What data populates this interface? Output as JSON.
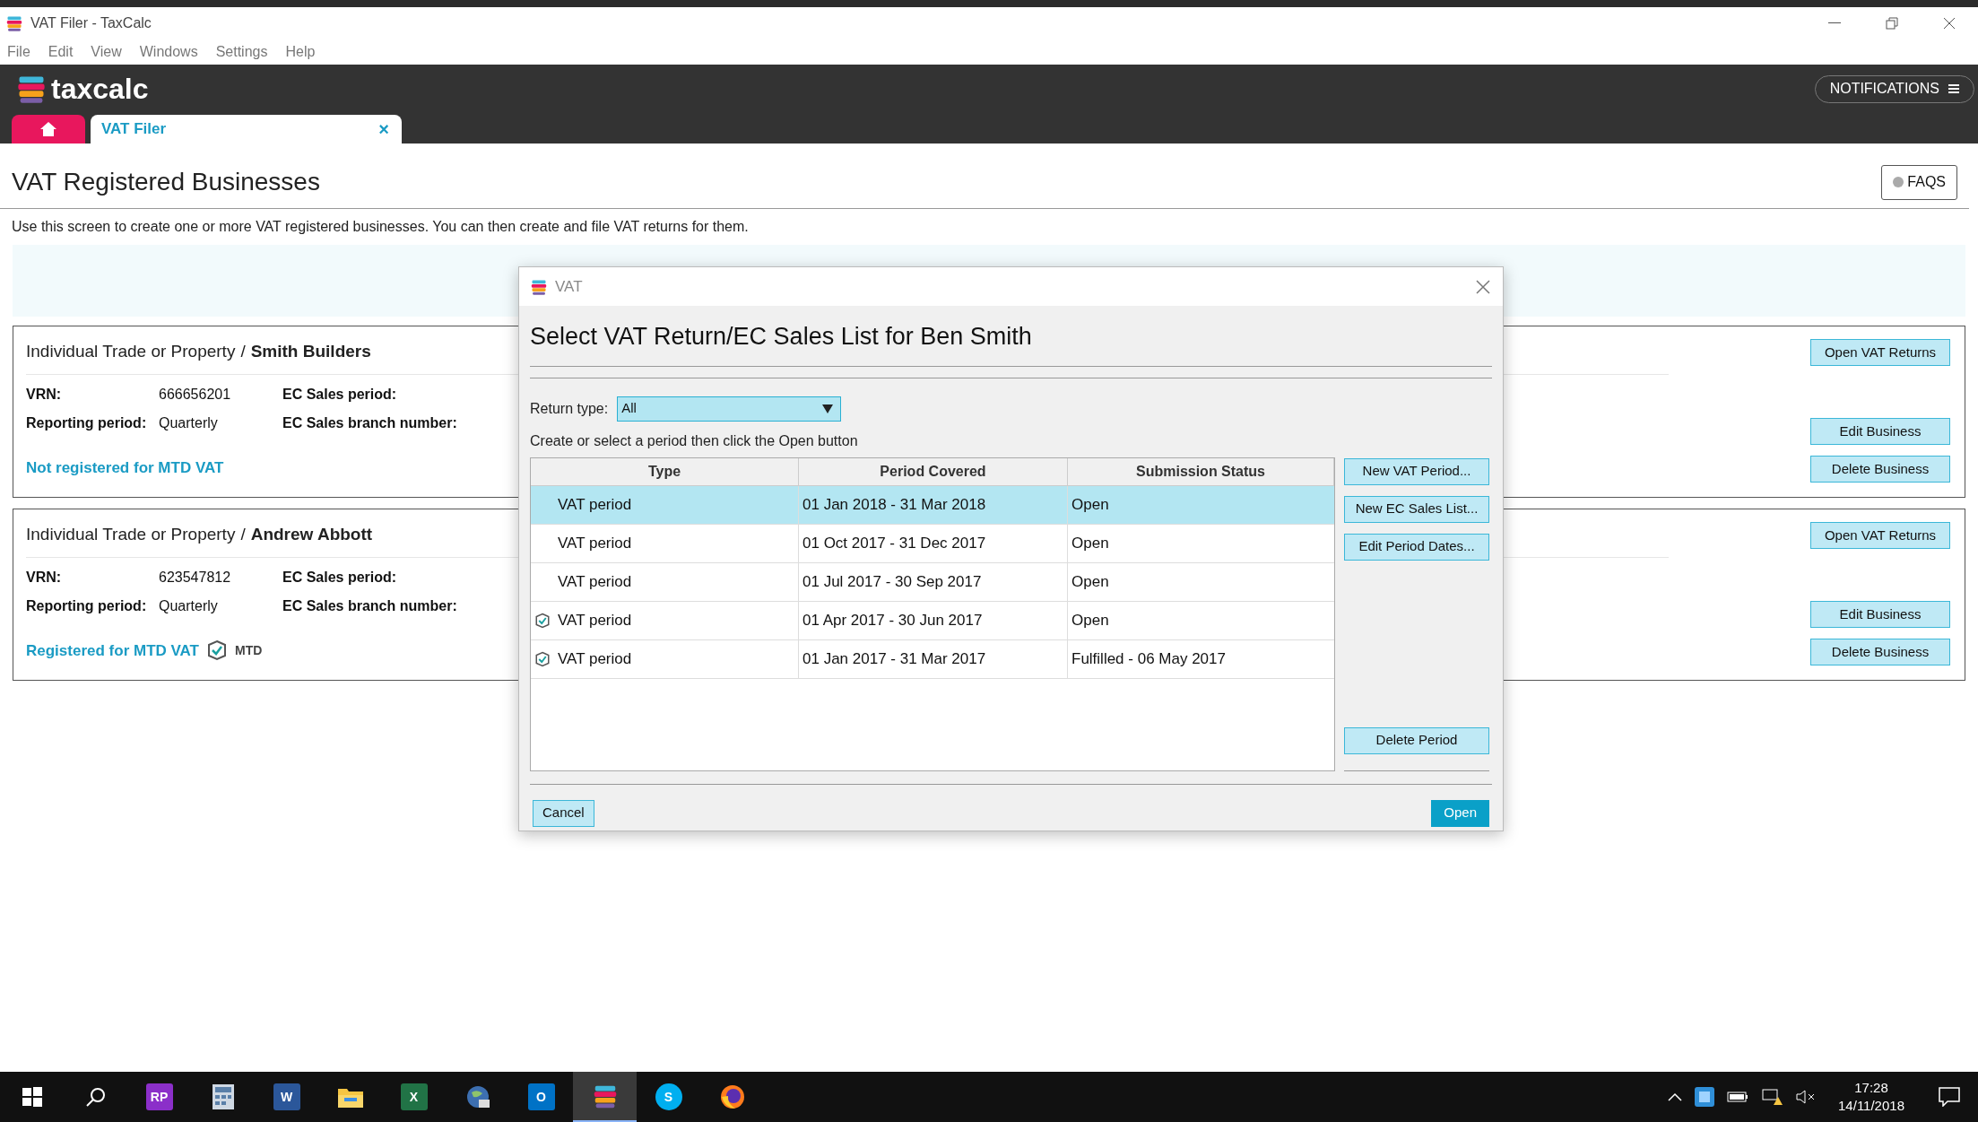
{
  "window": {
    "title": "VAT Filer - TaxCalc"
  },
  "menu": [
    "File",
    "Edit",
    "View",
    "Windows",
    "Settings",
    "Help"
  ],
  "header": {
    "logo": "taxcalc",
    "notifications": "NOTIFICATIONS"
  },
  "tabs": [
    {
      "kind": "home",
      "selected": false
    },
    {
      "kind": "document",
      "label": "VAT Filer",
      "close": "×",
      "selected": true
    }
  ],
  "page": {
    "title": "VAT Registered Businesses",
    "faqs": "FAQS",
    "description": "Use this screen to create one or more VAT registered businesses. You can then create and file VAT returns for them."
  },
  "businesses": [
    {
      "category": "Individual Trade or Property",
      "separator": "/",
      "name": "Smith Builders",
      "vrn_label": "VRN:",
      "vrn": "666656201",
      "period_label": "Reporting period:",
      "period": "Quarterly",
      "ec_period_label": "EC Sales period:",
      "ec_branch_label": "EC Sales branch number:",
      "mtd_status": "Not registered for MTD VAT",
      "buttons": [
        "Open VAT Returns",
        "Edit Business",
        "Delete Business"
      ]
    },
    {
      "category": "Individual Trade or Property",
      "separator": "/",
      "name": "Andrew Abbott",
      "vrn_label": "VRN:",
      "vrn": "623547812",
      "period_label": "Reporting period:",
      "period": "Quarterly",
      "ec_period_label": "EC Sales period:",
      "ec_branch_label": "EC Sales branch number:",
      "mtd_status": "Registered for MTD VAT",
      "mtd_badge": "MTD",
      "buttons": [
        "Open VAT Returns",
        "Edit Business",
        "Delete Business"
      ]
    }
  ],
  "dialog": {
    "title": "VAT",
    "heading": "Select VAT Return/EC Sales List for Ben Smith",
    "return_type_label": "Return type:",
    "return_type": "All",
    "instruction": "Create or select a period then click the Open button",
    "columns": [
      "Type",
      "Period Covered",
      "Submission Status"
    ],
    "rows": [
      {
        "type": "VAT period",
        "period": "01 Jan 2018 - 31 Mar 2018",
        "status": "Open",
        "mtd_icon": false,
        "selected": true
      },
      {
        "type": "VAT period",
        "period": "01 Oct 2017 - 31 Dec 2017",
        "status": "Open",
        "mtd_icon": false,
        "selected": false
      },
      {
        "type": "VAT period",
        "period": "01 Jul 2017 - 30 Sep 2017",
        "status": "Open",
        "mtd_icon": false,
        "selected": false
      },
      {
        "type": "VAT period",
        "period": "01 Apr 2017 - 30 Jun 2017",
        "status": "Open",
        "mtd_icon": true,
        "selected": false
      },
      {
        "type": "VAT period",
        "period": "01 Jan 2017 - 31 Mar 2017",
        "status": "Fulfilled - 06 May 2017",
        "mtd_icon": true,
        "selected": false
      }
    ],
    "side_buttons": [
      "New VAT Period...",
      "New EC Sales List...",
      "Edit Period Dates..."
    ],
    "delete_button": "Delete Period",
    "cancel": "Cancel",
    "open": "Open"
  },
  "taskbar": {
    "apps": [
      {
        "kind": "windows",
        "selected": false
      },
      {
        "kind": "search",
        "selected": false
      },
      {
        "kind": "rp",
        "label": "RP",
        "selected": false
      },
      {
        "kind": "calculator",
        "selected": false
      },
      {
        "kind": "word",
        "label": "W",
        "selected": false
      },
      {
        "kind": "folder",
        "selected": false
      },
      {
        "kind": "excel",
        "label": "X",
        "selected": false
      },
      {
        "kind": "globe",
        "selected": false
      },
      {
        "kind": "outlook",
        "label": "O",
        "selected": false
      },
      {
        "kind": "taxcalc",
        "selected": true
      },
      {
        "kind": "skype",
        "label": "S",
        "selected": false
      },
      {
        "kind": "firefox",
        "selected": false
      }
    ],
    "time": "17:28",
    "date": "14/11/2018"
  }
}
